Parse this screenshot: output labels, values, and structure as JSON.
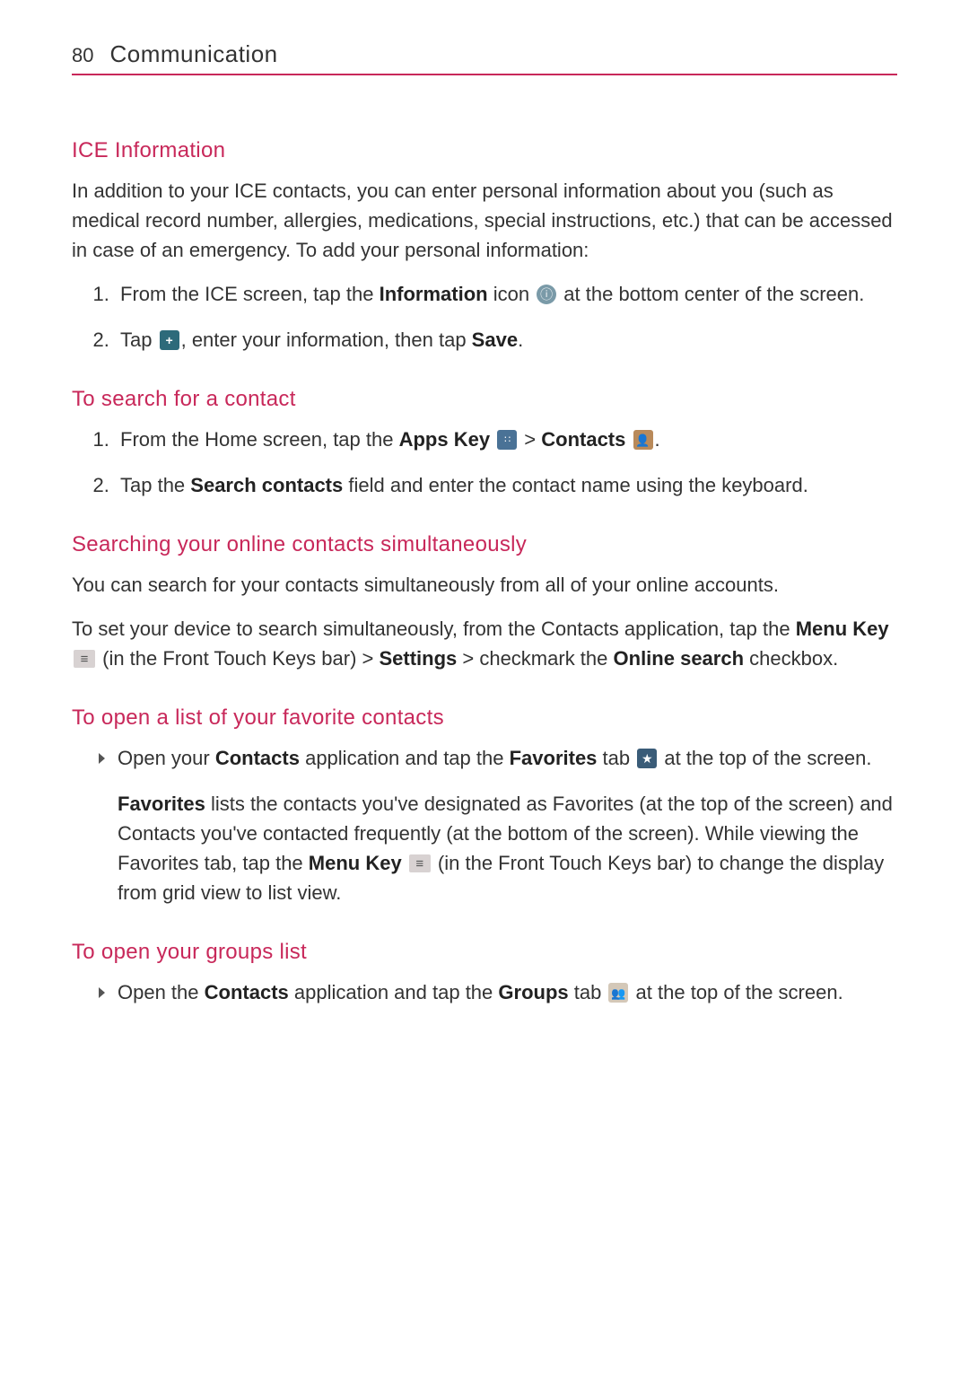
{
  "page_number": "80",
  "page_title": "Communication",
  "section_ice": {
    "heading": "ICE Information",
    "intro": "In addition to your ICE contacts, you can enter personal information about you (such as medical record number, allergies, medications, special instructions, etc.) that can be accessed in case of an emergency.  To add your personal information:",
    "step1_a": "From the ICE screen, tap the ",
    "step1_b_bold": "Information",
    "step1_c": " icon ",
    "step1_d": " at the bottom center of the screen.",
    "step2_a": "Tap ",
    "step2_b": ", enter your information, then tap ",
    "step2_c_bold": "Save",
    "step2_d": "."
  },
  "section_search": {
    "heading": "To search for a contact",
    "step1_a": "From the Home screen, tap the ",
    "step1_b_bold": "Apps Key ",
    "step1_c": " > ",
    "step1_d_bold": "Contacts ",
    "step1_e": ".",
    "step2_a": "Tap the ",
    "step2_b_bold": "Search contacts",
    "step2_c": " field and enter the contact name using the keyboard."
  },
  "section_online": {
    "heading": "Searching your online contacts simultaneously",
    "para1": "You can search for your contacts simultaneously from all of your online accounts.",
    "para2_a": "To set your device to search simultaneously, from the Contacts application, tap the ",
    "para2_b_bold": "Menu Key ",
    "para2_c": " (in the Front Touch Keys bar) > ",
    "para2_d_bold": "Settings",
    "para2_e": " > checkmark the ",
    "para2_f_bold": "Online search",
    "para2_g": " checkbox."
  },
  "section_favorites": {
    "heading": "To open a list of your favorite contacts",
    "bullet_a": "Open your ",
    "bullet_b_bold": "Contacts",
    "bullet_c": " application and tap the ",
    "bullet_d_bold": "Favorites",
    "bullet_e": " tab ",
    "bullet_f": " at the top of the screen.",
    "para_a_bold": "Favorites",
    "para_b": " lists the contacts you've designated as Favorites (at the top of the screen) and Contacts you've contacted frequently (at the bottom of the screen). While viewing the Favorites tab, tap the ",
    "para_c_bold": "Menu Key ",
    "para_d": " (in the Front Touch Keys bar) to change the display from grid view to list view."
  },
  "section_groups": {
    "heading": "To open your groups list",
    "bullet_a": "Open the ",
    "bullet_b_bold": "Contacts",
    "bullet_c": " application and tap the ",
    "bullet_d_bold": "Groups",
    "bullet_e": " tab ",
    "bullet_f": " at the top of the screen."
  },
  "icons": {
    "info": "ⓘ",
    "add": "+",
    "apps": "∷",
    "contacts": "👤",
    "star": "★",
    "groups": "👥",
    "menu": "≡"
  }
}
